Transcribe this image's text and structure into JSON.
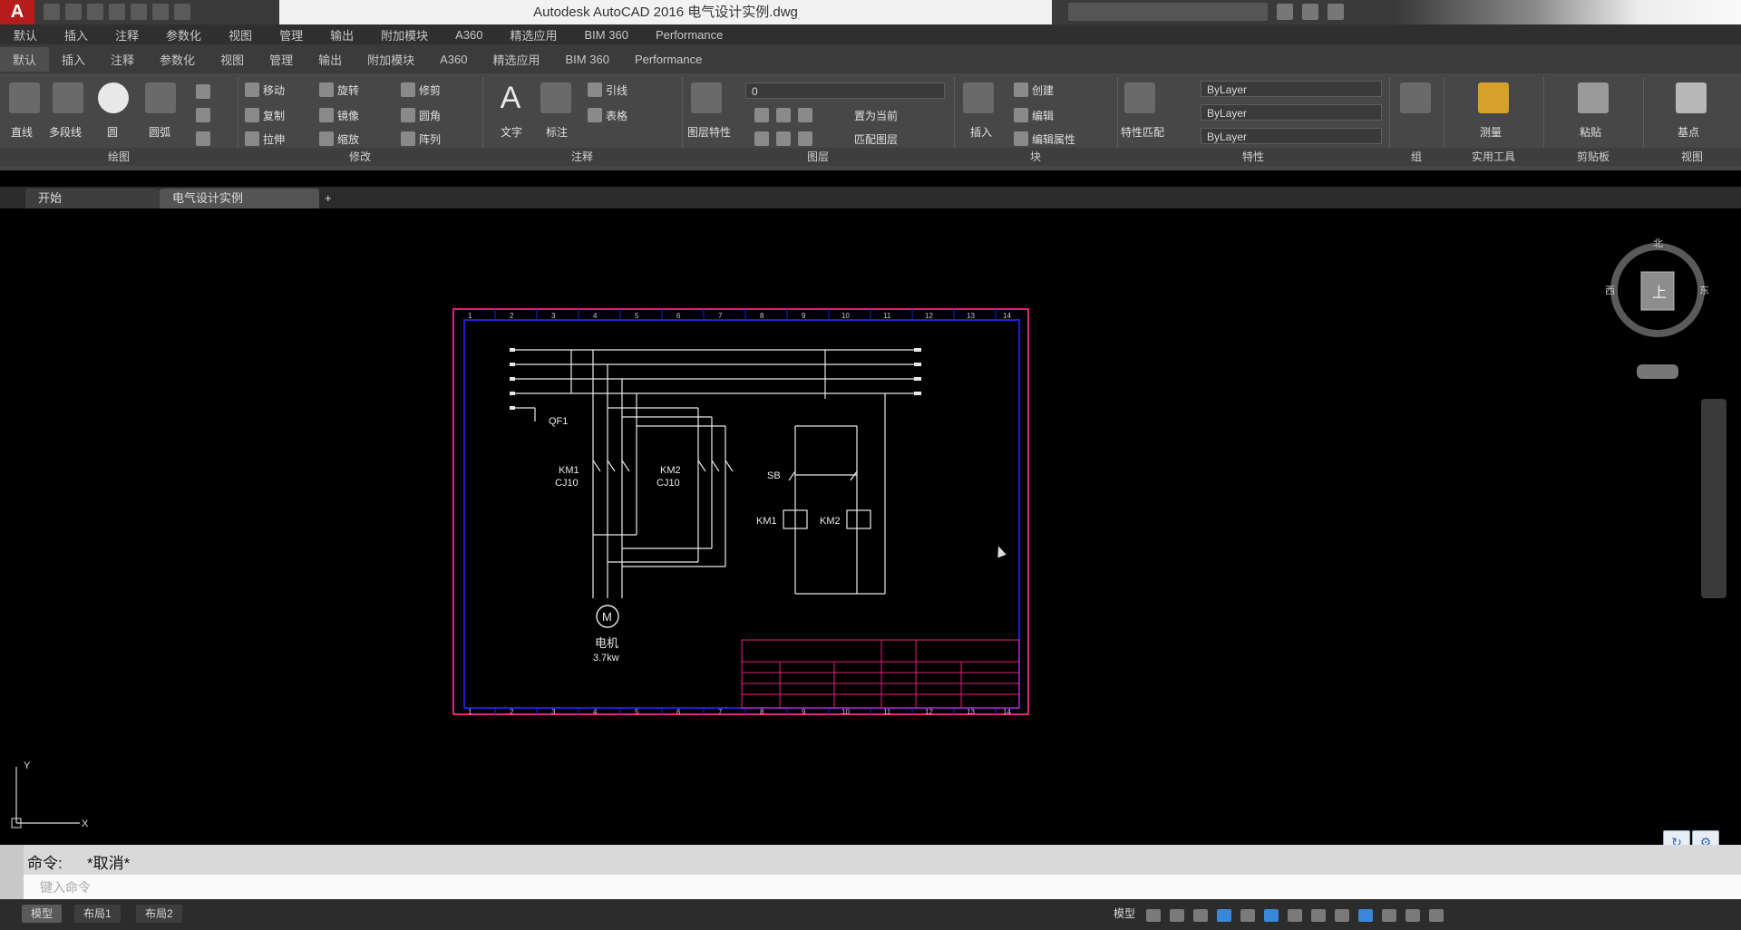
{
  "app": {
    "logo_letter": "A",
    "title": "Autodesk AutoCAD 2016    电气设计实例.dwg"
  },
  "menu": [
    "默认",
    "插入",
    "注释",
    "参数化",
    "视图",
    "管理",
    "输出",
    "附加模块",
    "A360",
    "精选应用",
    "BIM 360",
    "Performance"
  ],
  "ribbon": {
    "panels": [
      {
        "title": "绘图"
      },
      {
        "title": "修改"
      },
      {
        "title": "注释"
      },
      {
        "title": "图层"
      },
      {
        "title": "块"
      },
      {
        "title": "特性"
      },
      {
        "title": "组"
      },
      {
        "title": "实用工具"
      },
      {
        "title": "剪贴板"
      },
      {
        "title": "视图"
      }
    ],
    "draw_tools": [
      "直线",
      "多段线",
      "圆",
      "圆弧"
    ],
    "modify_tools": [
      "移动",
      "旋转",
      "修剪",
      "复制",
      "镜像",
      "圆角",
      "拉伸",
      "缩放",
      "阵列"
    ],
    "annotation_tools": [
      "文字",
      "标注",
      "引线",
      "表格"
    ],
    "layer_tools": [
      "图层特性",
      "置为当前",
      "匹配图层"
    ],
    "layer_value": "0",
    "block_tools": [
      "插入",
      "创建",
      "编辑",
      "编辑属性"
    ],
    "properties": {
      "color": "ByLayer",
      "linetype": "ByLayer",
      "lineweight": "ByLayer",
      "match": "特性匹配"
    },
    "group_label": "组",
    "utilities_label": "测量",
    "clipboard_label": "粘贴",
    "view_label": "基点"
  },
  "file_tabs": [
    {
      "label": "开始"
    },
    {
      "label": "电气设计实例"
    }
  ],
  "add_tab": "+",
  "drawing": {
    "breaker_label": "QF1",
    "contactor1_label": "KM1",
    "contactor1_model": "CJ10",
    "contactor2_label": "KM2",
    "contactor2_model": "CJ10",
    "switch_label": "SB",
    "coil1_label": "KM1",
    "coil2_label": "KM2",
    "motor_symbol": "M",
    "motor_name": "电机",
    "motor_spec": "3.7kw",
    "grid_top": [
      "1",
      "2",
      "3",
      "4",
      "5",
      "6",
      "7",
      "8",
      "9",
      "10",
      "11",
      "12",
      "13",
      "14"
    ],
    "grid_bottom": [
      "1",
      "2",
      "3",
      "4",
      "5",
      "6",
      "7",
      "8",
      "9",
      "10",
      "11",
      "12",
      "13",
      "14"
    ]
  },
  "viewcube": {
    "top_label": "北",
    "left_label": "西",
    "right_label": "东",
    "face_label": "上"
  },
  "ucs": {
    "x_label": "X",
    "y_label": "Y"
  },
  "command": {
    "history_prefix": "命令:",
    "history_text": "*取消*",
    "prompt_placeholder": "键入命令"
  },
  "status": {
    "tabs": [
      "模型",
      "布局1",
      "布局2"
    ],
    "model_label": "模型"
  },
  "colors": {
    "magenta": "#e0207a",
    "grid_blue": "#1f1fd0",
    "wire": "#e8e8e8"
  }
}
